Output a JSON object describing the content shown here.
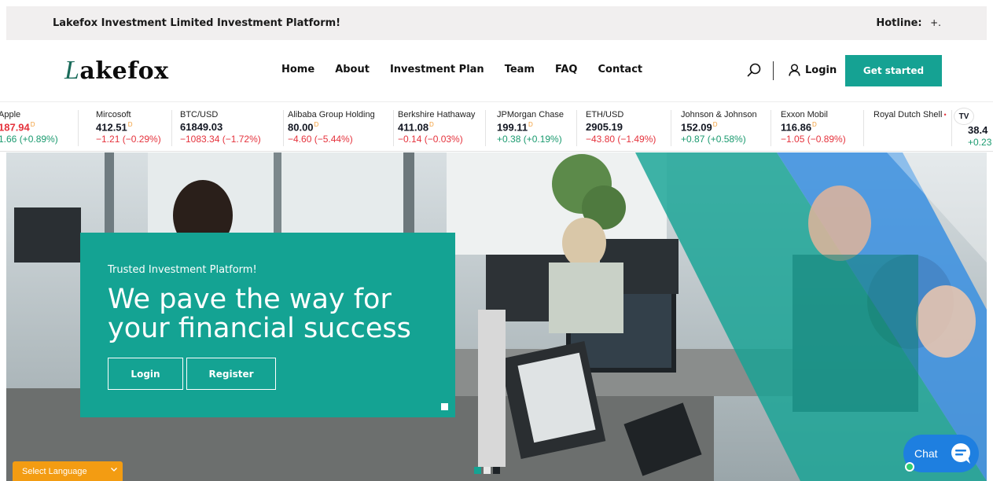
{
  "topbar": {
    "tagline": "Lakefox Investment Limited Investment Platform!",
    "hotline_label": "Hotline:",
    "hotline_value": "+."
  },
  "header": {
    "logo_initial": "L",
    "logo_rest": "akefox",
    "nav": [
      "Home",
      "About",
      "Investment Plan",
      "Team",
      "FAQ",
      "Contact"
    ],
    "login_label": "Login",
    "cta_label": "Get started"
  },
  "ticker": [
    {
      "name": "Apple",
      "price": "187.94",
      "change": "1.66 (+0.89%)",
      "price_color": "red",
      "change_dir": "pos",
      "delayed": true
    },
    {
      "name": "Mircosoft",
      "price": "412.51",
      "change": "−1.21 (−0.29%)",
      "price_color": "dark",
      "change_dir": "neg",
      "delayed": true
    },
    {
      "name": "BTC/USD",
      "price": "61849.03",
      "change": "−1083.34 (−1.72%)",
      "price_color": "dark",
      "change_dir": "neg",
      "delayed": false
    },
    {
      "name": "Alibaba Group Holding",
      "price": "80.00",
      "change": "−4.60 (−5.44%)",
      "price_color": "dark",
      "change_dir": "neg",
      "delayed": true
    },
    {
      "name": "Berkshire Hathaway",
      "price": "411.08",
      "change": "−0.14 (−0.03%)",
      "price_color": "dark",
      "change_dir": "neg",
      "delayed": true
    },
    {
      "name": "JPMorgan Chase",
      "price": "199.11",
      "change": "+0.38 (+0.19%)",
      "price_color": "dark",
      "change_dir": "pos",
      "delayed": true
    },
    {
      "name": "ETH/USD",
      "price": "2905.19",
      "change": "−43.80 (−1.49%)",
      "price_color": "dark",
      "change_dir": "neg",
      "delayed": false
    },
    {
      "name": "Johnson & Johnson",
      "price": "152.09",
      "change": "+0.87 (+0.58%)",
      "price_color": "dark",
      "change_dir": "pos",
      "delayed": true
    },
    {
      "name": "Exxon Mobil",
      "price": "116.86",
      "change": "−1.05 (−0.89%)",
      "price_color": "dark",
      "change_dir": "neg",
      "delayed": true
    },
    {
      "name": "Royal Dutch Shell",
      "price": "",
      "change": "",
      "price_color": "dark",
      "change_dir": "neg",
      "delayed": false,
      "live": true
    },
    {
      "name": "",
      "price": "38.4",
      "change": "+0.23",
      "price_color": "dark",
      "change_dir": "pos",
      "delayed": false
    }
  ],
  "ticker_delay_marker": "D",
  "ticker_live_marker": "•",
  "tradingview_mark": "TV",
  "hero": {
    "kicker": "Trusted Investment Platform!",
    "headline": "We pave the way for your financial success",
    "login_label": "Login",
    "register_label": "Register",
    "accent_color": "#14a393"
  },
  "language_select": {
    "label": "Select Language"
  },
  "chat": {
    "label": "Chat"
  },
  "icons": [
    "search-icon",
    "user-icon",
    "chevron-down-icon",
    "chat-bubble-icon",
    "tradingview-logo-icon"
  ]
}
